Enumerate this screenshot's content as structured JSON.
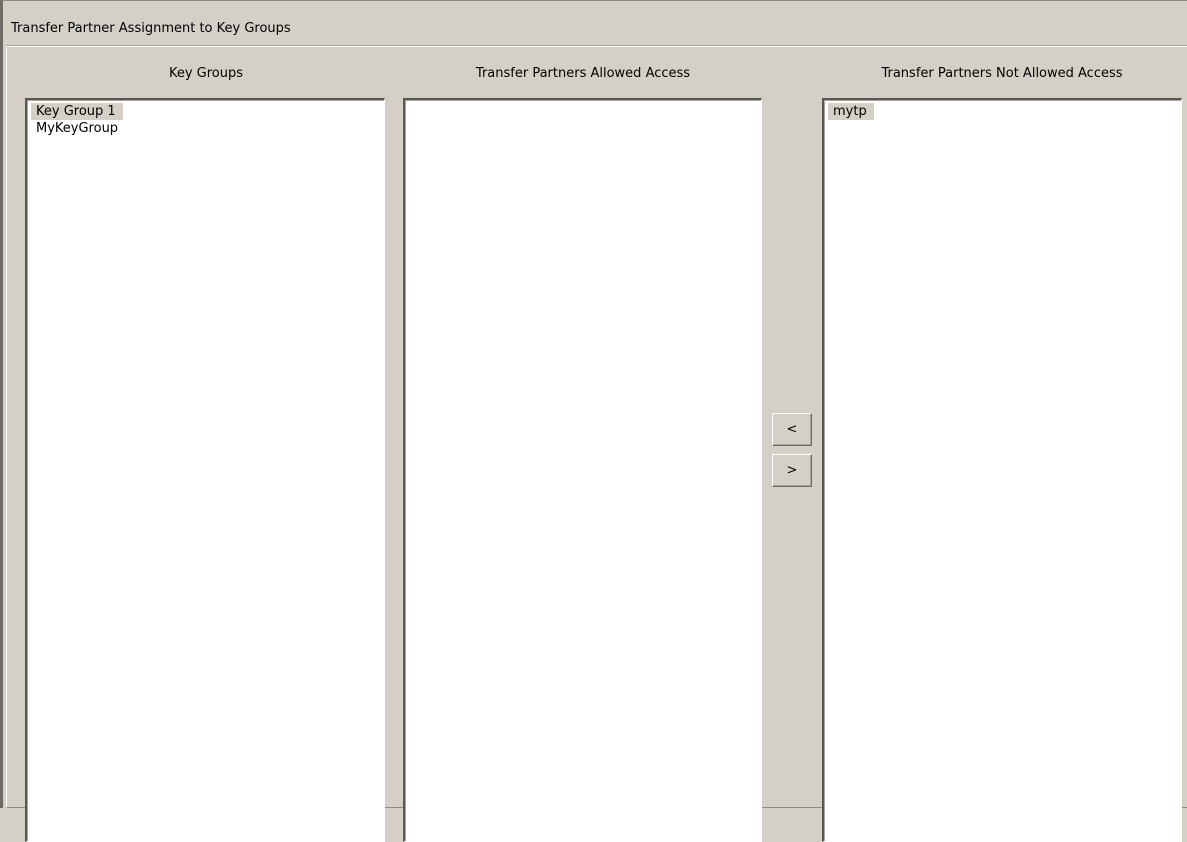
{
  "window": {
    "title": "Transfer Partner Assignment to Key Groups"
  },
  "columns": {
    "key_groups": {
      "header": "Key Groups",
      "items": [
        {
          "label": "Key Group 1",
          "selected": true
        },
        {
          "label": "MyKeyGroup",
          "selected": false
        }
      ]
    },
    "allowed": {
      "header": "Transfer Partners Allowed Access",
      "items": []
    },
    "not_allowed": {
      "header": "Transfer Partners Not Allowed Access",
      "items": [
        {
          "label": "mytp",
          "selected": true
        }
      ]
    }
  },
  "buttons": {
    "move_left_label": "<",
    "move_right_label": ">"
  },
  "colors": {
    "background": "#d4d0c8",
    "list_background": "#ffffff",
    "selection": "#d4d0c8"
  }
}
